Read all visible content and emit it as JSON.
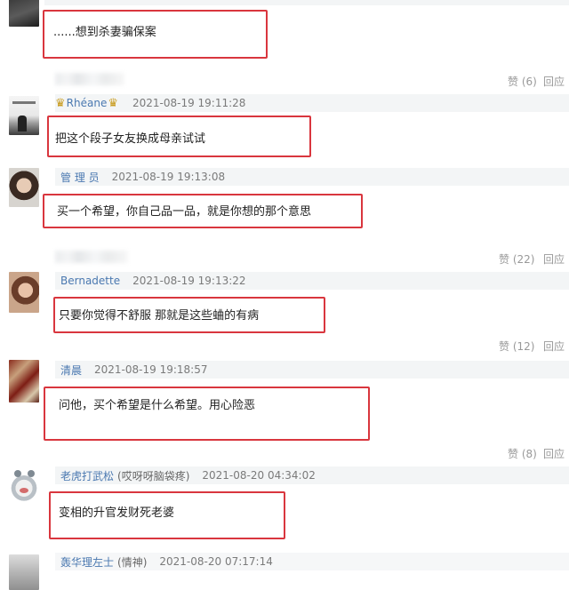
{
  "comments": [
    {
      "username": "",
      "timestamp": "",
      "text": "......想到杀妻骗保案",
      "likes": "赞 (6)",
      "reply": "回应"
    },
    {
      "username": "Rhéane",
      "timestamp": "2021-08-19 19:11:28",
      "text": "把这个段子女友换成母亲试试"
    },
    {
      "username": "管 理 员",
      "timestamp": "2021-08-19 19:13:08",
      "text": "买一个希望，你自己品一品，就是你想的那个意思",
      "likes": "赞 (22)",
      "reply": "回应"
    },
    {
      "username": "Bernadette",
      "timestamp": "2021-08-19 19:13:22",
      "text": "只要你觉得不舒服 那就是这些蛐的有病",
      "likes": "赞 (12)",
      "reply": "回应"
    },
    {
      "username": "清晨",
      "timestamp": "2021-08-19 19:18:57",
      "text": "问他，买个希望是什么希望。用心险恶",
      "likes": "赞 (8)",
      "reply": "回应"
    },
    {
      "username": "老虎打武松",
      "nickname": "(哎呀呀脑袋疼)",
      "timestamp": "2021-08-20 04:34:02",
      "text": "变相的升官发财死老婆"
    },
    {
      "username": "轰华理左士",
      "nickname": "(情神)",
      "timestamp": "2021-08-20 07:17:14"
    }
  ],
  "colors": {
    "username": "#4a78b0",
    "highlight_box": "#d9363e",
    "meta_bar": "#f3f5f6"
  }
}
